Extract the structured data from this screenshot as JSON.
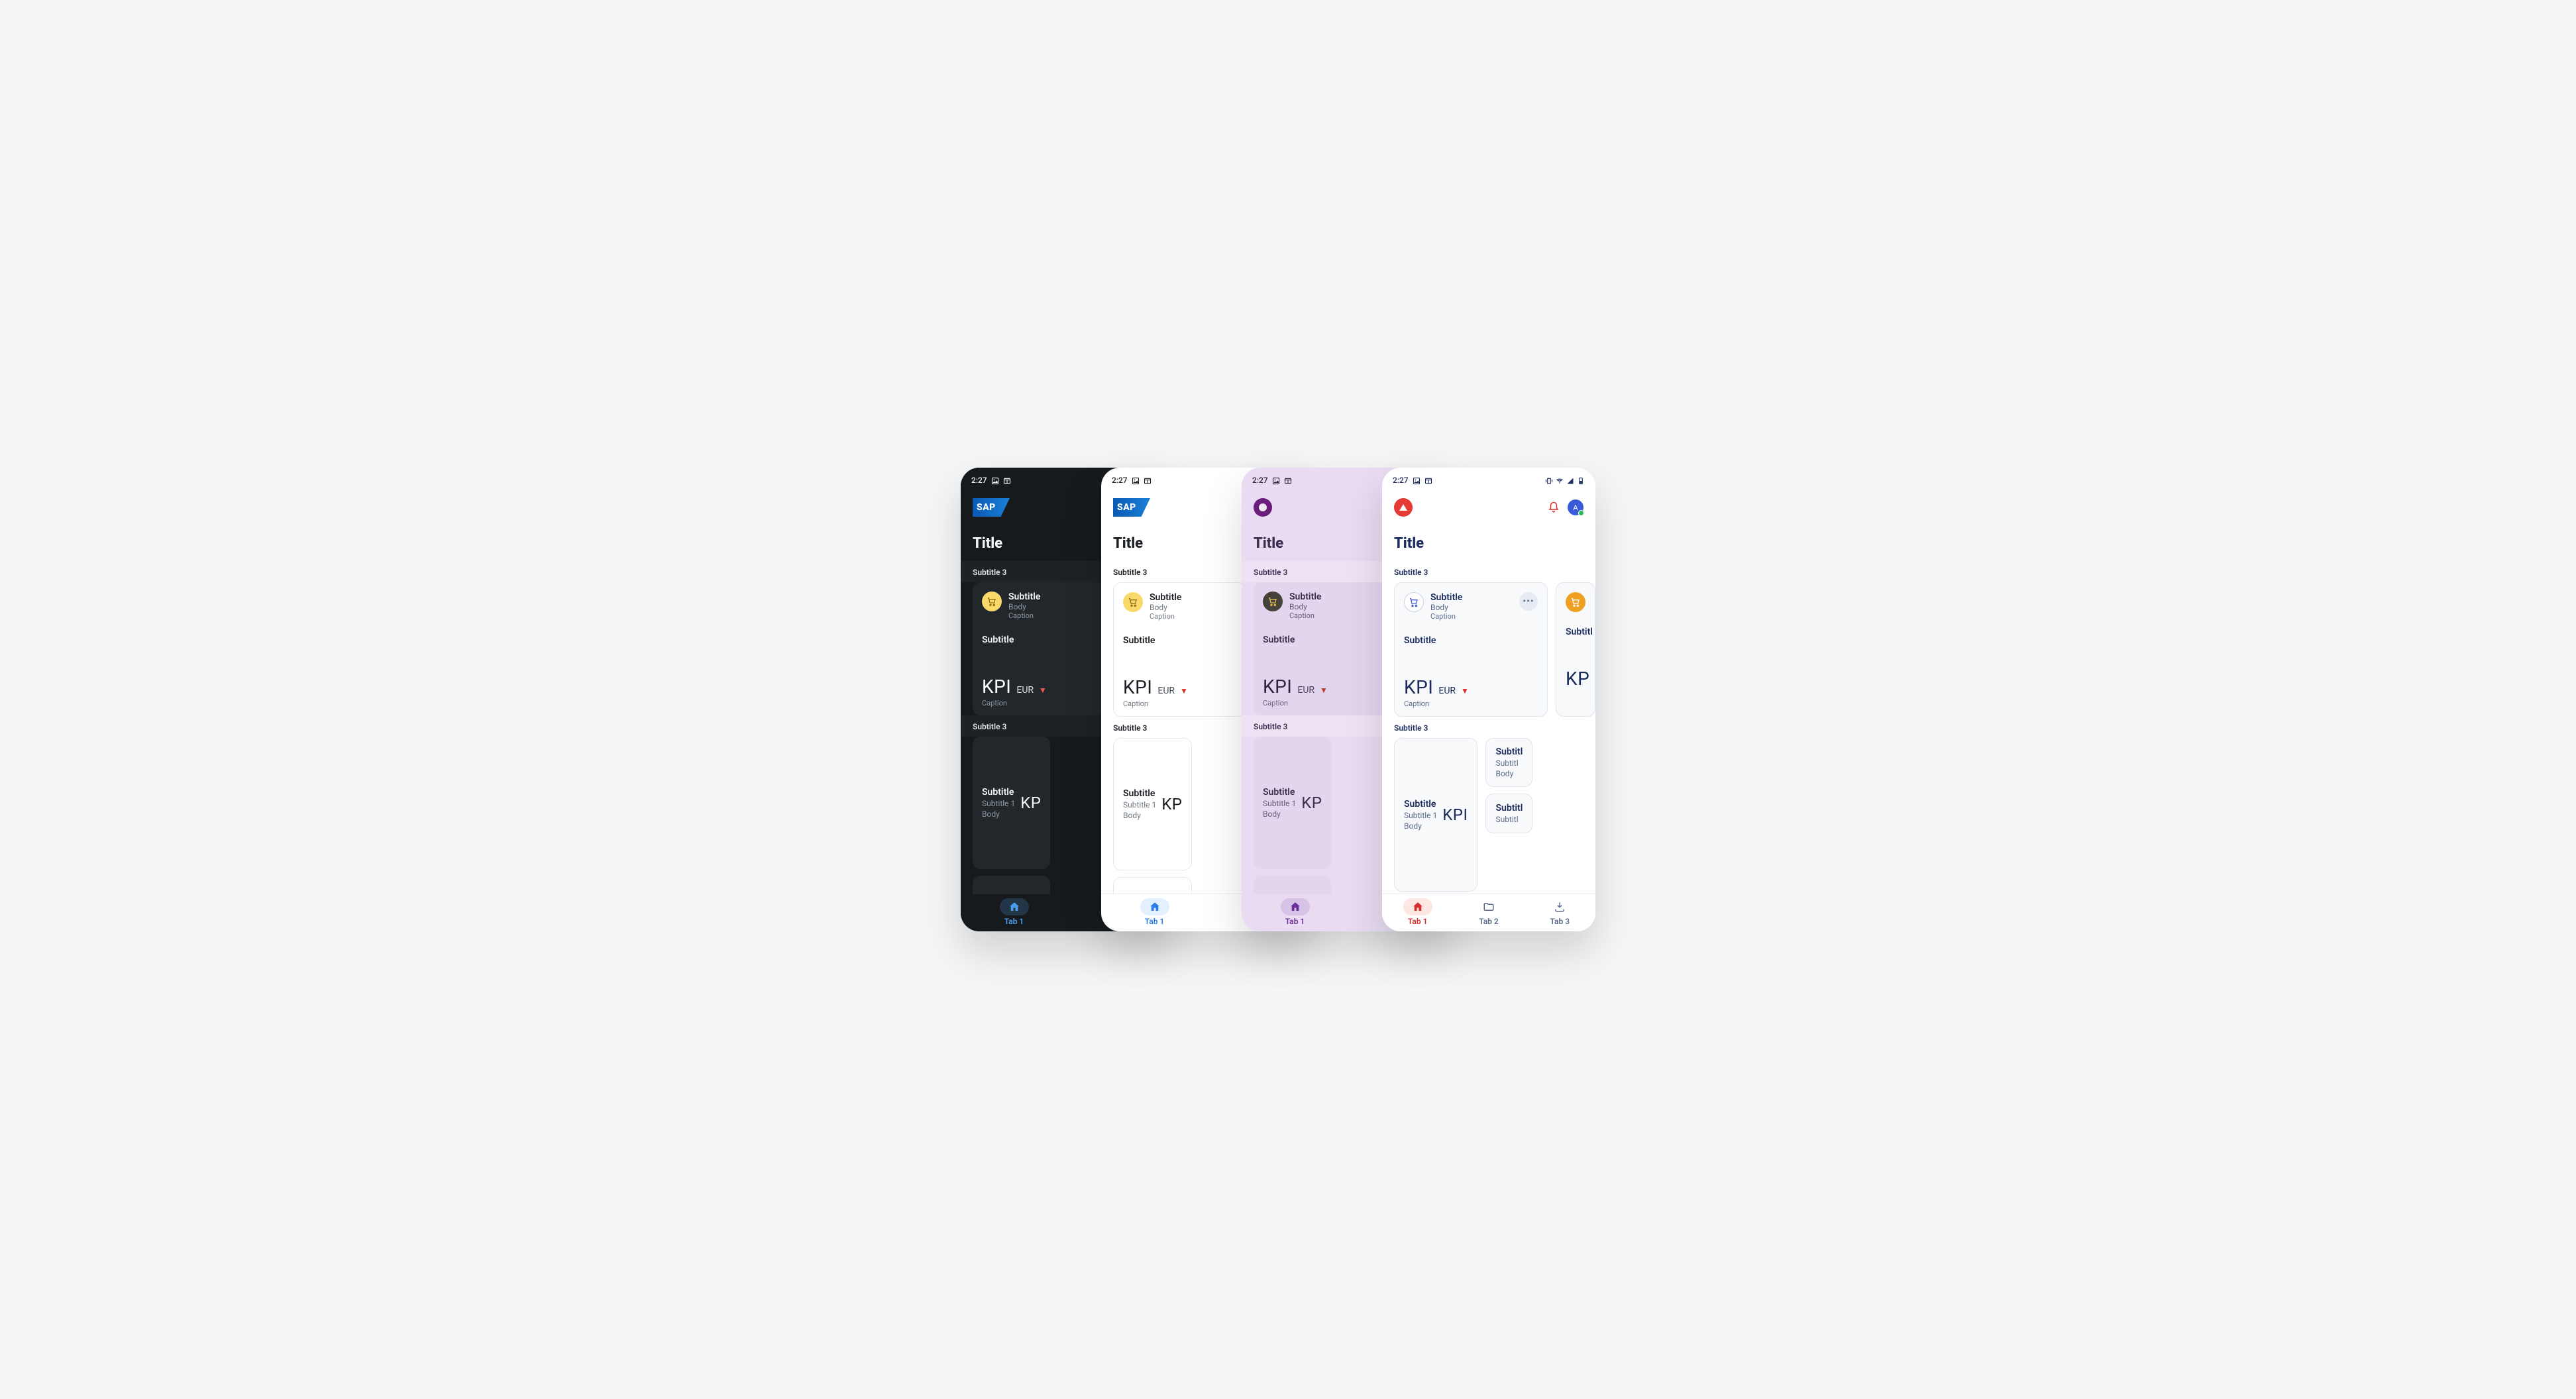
{
  "status": {
    "time": "2:27"
  },
  "header": {
    "title": "Title"
  },
  "section1": {
    "header": "Subtitle 3",
    "card": {
      "subtitle": "Subtitle",
      "body": "Body",
      "caption": "Caption",
      "subtitle2": "Subtitle",
      "kpi": "KPI",
      "currency": "EUR",
      "kpi_caption": "Caption"
    }
  },
  "section2": {
    "header": "Subtitle 3",
    "item": {
      "subtitle": "Subtitle",
      "subtitle1": "Subtitle 1",
      "body": "Body",
      "kpi": "KPI"
    },
    "peek": "Subtitl"
  },
  "nav": {
    "tab1": "Tab 1",
    "tab2": "Tab 2",
    "tab3": "Tab 3"
  },
  "brand": {
    "avatar": "A",
    "more": "•••"
  },
  "peek_kpi": "KP"
}
